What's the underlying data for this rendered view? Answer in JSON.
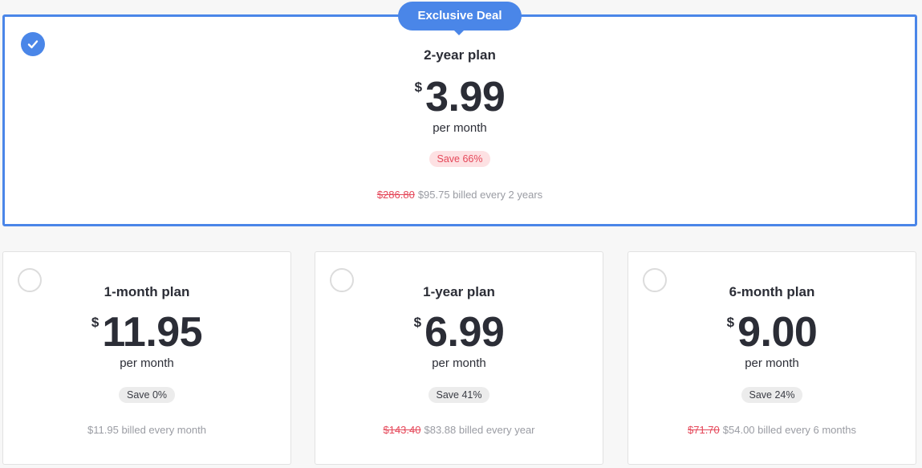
{
  "featured": {
    "badge": "Exclusive Deal",
    "plan_name": "2-year plan",
    "currency": "$",
    "price": "3.99",
    "per_month": "per month",
    "save": "Save 66%",
    "original_price": "$286.80",
    "billed": "$95.75 billed every 2 years",
    "selected": true
  },
  "plans": [
    {
      "plan_name": "1-month plan",
      "currency": "$",
      "price": "11.95",
      "per_month": "per month",
      "save": "Save 0%",
      "original_price": "",
      "billed": "$11.95 billed every month",
      "selected": false
    },
    {
      "plan_name": "1-year plan",
      "currency": "$",
      "price": "6.99",
      "per_month": "per month",
      "save": "Save 41%",
      "original_price": "$143.40",
      "billed": "$83.88 billed every year",
      "selected": false
    },
    {
      "plan_name": "6-month plan",
      "currency": "$",
      "price": "9.00",
      "per_month": "per month",
      "save": "Save 24%",
      "original_price": "$71.70",
      "billed": "$54.00 billed every 6 months",
      "selected": false
    }
  ],
  "colors": {
    "accent": "#4a86e8",
    "discount_red": "#e5485a",
    "save_red_bg": "#fde1e3",
    "save_gray_bg": "#ececec"
  }
}
